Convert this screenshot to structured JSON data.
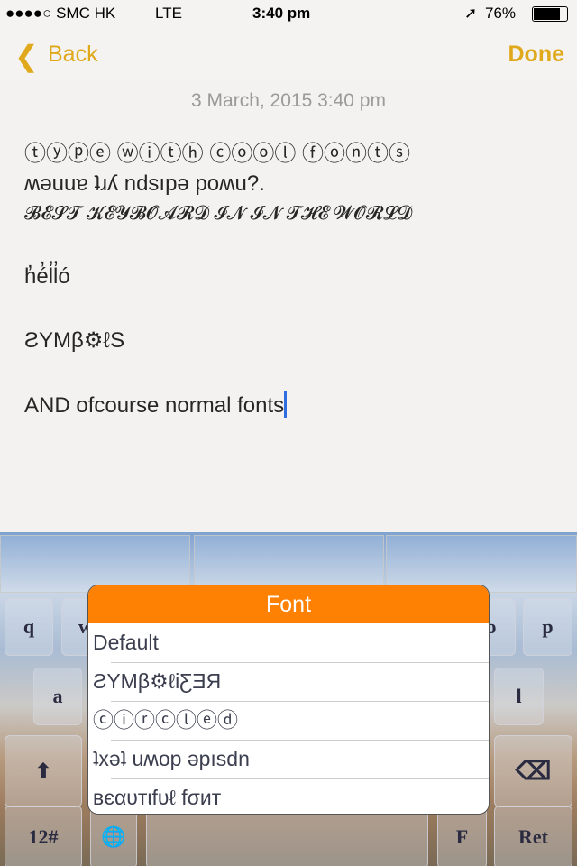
{
  "status": {
    "carrier": "●●●●○ SMC HK",
    "network": "LTE",
    "time": "3:40 pm",
    "battery": "76%",
    "battery_level": 0.76
  },
  "nav": {
    "back": "Back",
    "done": "Done"
  },
  "note": {
    "date": "3 March, 2015 3:40 pm",
    "lines": [
      "ⓣⓨⓟⓔ ⓦⓘⓣⓗ ⓒⓞⓞⓛ ⓕⓞⓝⓣⓢ",
      "ʍǝuuɐ ʇɹʎ ndsıpǝ poʍu?.",
      "𝓑𝓔𝓢𝓣 𝓚𝓔𝓨𝓑𝓞𝓐𝓡𝓓 𝓘𝓝 𝓘𝓝 𝓣𝓗𝓔 𝓦𝓞𝓡𝓛𝓓",
      "h̓é̓l̓l̓ó",
      "ƧYMβ⚙ℓS",
      "AND ofcourse normal fonts"
    ]
  },
  "keyboard": {
    "keys": {
      "q": "q",
      "w": "w",
      "o": "o",
      "p": "p",
      "a": "a",
      "l": "l",
      "shift": "⬆",
      "delete": "⌫",
      "numbers": "12#",
      "globe": "🌐",
      "f": "F",
      "return": "Ret"
    }
  },
  "popup": {
    "title": "Font",
    "header_color": "#ff8104",
    "items": [
      "Default",
      "ƧYMβ⚙ℓiƸƎЯ",
      "ⓒⓘⓡⓒⓛⓔⓓ",
      "ʇxǝʇ uʍop ǝpısdn",
      "вєαυтιfυℓ fσит"
    ]
  }
}
